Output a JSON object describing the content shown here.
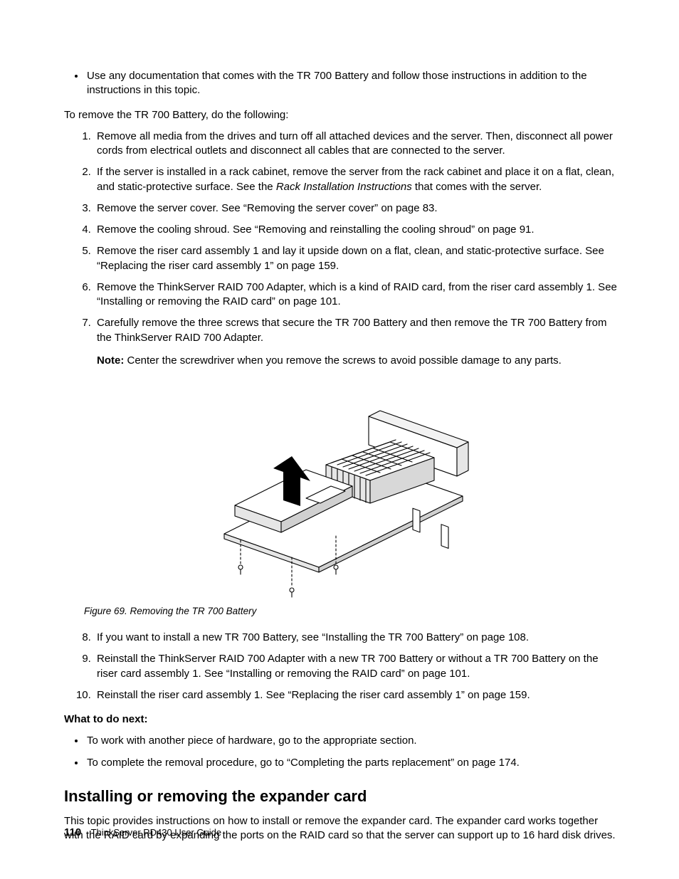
{
  "top_bullets": [
    "Use any documentation that comes with the TR 700 Battery and follow those instructions in addition to the instructions in this topic."
  ],
  "lead_in": "To remove the TR 700 Battery, do the following:",
  "steps_a": [
    "Remove all media from the drives and turn off all attached devices and the server. Then, disconnect all power cords from electrical outlets and disconnect all cables that are connected to the server.",
    {
      "pre": "If the server is installed in a rack cabinet, remove the server from the rack cabinet and place it on a flat, clean, and static-protective surface. See the ",
      "italic": "Rack Installation Instructions",
      "post": " that comes with the server."
    },
    "Remove the server cover. See “Removing the server cover” on page 83.",
    "Remove the cooling shroud. See “Removing and reinstalling the cooling shroud” on page 91.",
    "Remove the riser card assembly 1 and lay it upside down on a flat, clean, and static-protective surface. See “Replacing the riser card assembly 1” on page 159.",
    "Remove the ThinkServer RAID 700 Adapter, which is a kind of RAID card, from the riser card assembly 1. See “Installing or removing the RAID card” on page 101.",
    "Carefully remove the three screws that secure the TR 700 Battery and then remove the TR 700 Battery from the ThinkServer RAID 700 Adapter."
  ],
  "note_label": "Note:",
  "note_text": " Center the screwdriver when you remove the screws to avoid possible damage to any parts.",
  "figure_caption": "Figure 69.  Removing the TR 700 Battery",
  "steps_b_start": 8,
  "steps_b": [
    "If you want to install a new TR 700 Battery, see “Installing the TR 700 Battery” on page 108.",
    "Reinstall the ThinkServer RAID 700 Adapter with a new TR 700 Battery or without a TR 700 Battery on the riser card assembly 1. See “Installing or removing the RAID card” on page 101.",
    "Reinstall the riser card assembly 1. See “Replacing the riser card assembly 1” on page 159."
  ],
  "what_next_heading": "What to do next:",
  "what_next_bullets": [
    "To work with another piece of hardware, go to the appropriate section.",
    "To complete the removal procedure, go to “Completing the parts replacement” on page 174."
  ],
  "section_heading": "Installing or removing the expander card",
  "section_body": "This topic provides instructions on how to install or remove the expander card. The expander card works together with the RAID card by expanding the ports on the RAID card so that the server can support up to 16 hard disk drives.",
  "footer_page": "110",
  "footer_text": "ThinkServer RD430 User Guide"
}
